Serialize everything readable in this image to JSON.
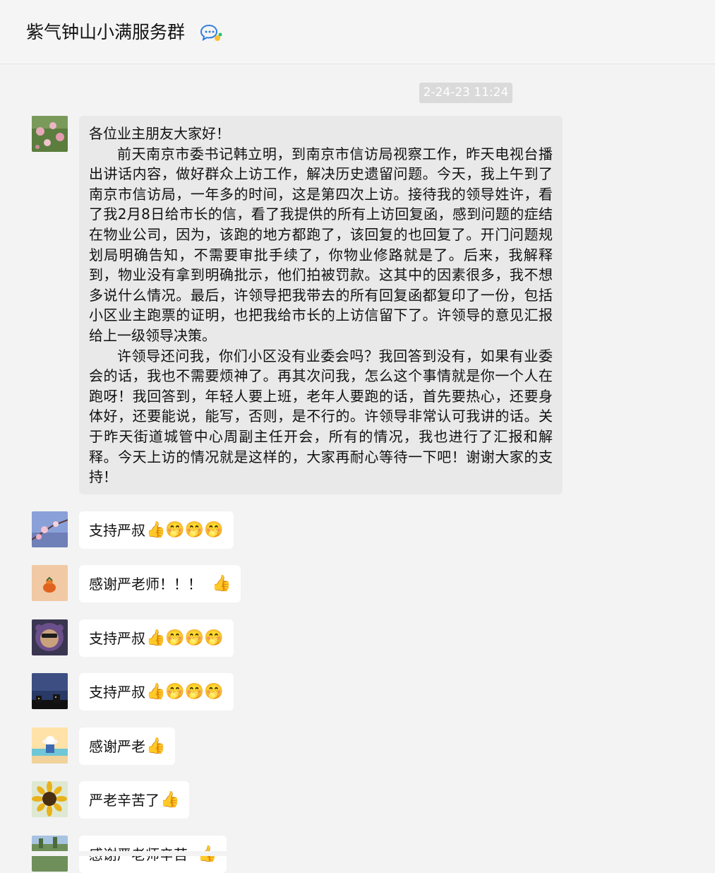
{
  "header": {
    "title": "紫气钟山小满服务群",
    "icon": "group-chat-icon"
  },
  "timestamp": "2-24-23 11:24",
  "long_message": {
    "greeting": "各位业主朋友大家好！",
    "paragraph_1": "前天南京市委书记韩立明，到南京市信访局视察工作，昨天电视台播出讲话内容，做好群众上访工作，解决历史遗留问题。今天，我上午到了南京市信访局，一年多的时间，这是第四次上访。接待我的领导姓许，看了我2月8日给市长的信，看了我提供的所有上访回复函，感到问题的症结在物业公司，因为，该跑的地方都跑了，该回复的也回复了。开门问题规划局明确告知，不需要审批手续了，你物业修路就是了。后来，我解释到，物业没有拿到明确批示，他们拍被罚款。这其中的因素很多，我不想多说什么情况。最后，许领导把我带去的所有回复函都复印了一份，包括小区业主跑票的证明，也把我给市长的上访信留下了。许领导的意见汇报给上一级领导决策。",
    "paragraph_2": "许领导还问我，你们小区没有业委会吗？我回答到没有，如果有业委会的话，我也不需要烦神了。再其次问我，怎么这个事情就是你一个人在跑呀！我回答到，年轻人要上班，老年人要跑的话，首先要热心，还要身体好，还要能说，能写，否则，是不行的。许领导非常认可我讲的话。关于昨天街道城管中心周副主任开会，所有的情况，我也进行了汇报和解释。今天上访的情况就是这样的，大家再耐心等待一下吧！谢谢大家的支持！"
  },
  "replies": [
    {
      "text": "支持严叔",
      "emoji": "👍🤭🤭🤭",
      "avatar": "plum-blossom-avatar"
    },
    {
      "text": "感谢严老师！！！",
      "emoji": "👍",
      "avatar": "persimmon-avatar"
    },
    {
      "text": "支持严叔",
      "emoji": "👍🤭🤭🤭",
      "avatar": "cartoon-bear-avatar"
    },
    {
      "text": "支持严叔",
      "emoji": "👍🤭🤭🤭",
      "avatar": "night-city-avatar"
    },
    {
      "text": "感谢严老",
      "emoji": "👍",
      "avatar": "beach-hat-avatar"
    },
    {
      "text": "严老辛苦了",
      "emoji": "👍",
      "avatar": "sunflower-avatar"
    },
    {
      "text": "感谢严老师辛苦",
      "emoji": "👍",
      "avatar": "landscape-avatar"
    }
  ],
  "colors": {
    "background": "#f3f3f3",
    "bubble_grey": "#e9e9e9",
    "bubble_white": "#ffffff",
    "timestamp_bg": "#dadada"
  }
}
